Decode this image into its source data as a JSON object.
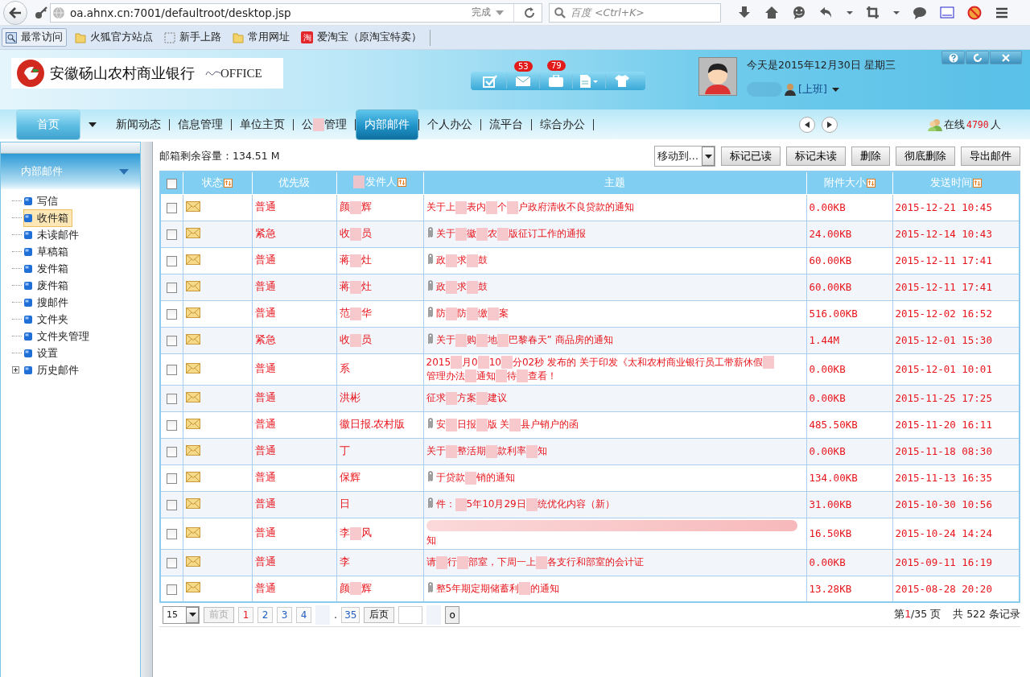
{
  "browser": {
    "url": "oa.ahnx.cn:7001/defaultroot/desktop.jsp",
    "status": "完成",
    "search_placeholder": "百度 <Ctrl+K>",
    "bookmarks": [
      {
        "label": "最常访问",
        "kind": "search"
      },
      {
        "label": "火狐官方站点",
        "kind": "folder"
      },
      {
        "label": "新手上路",
        "kind": "page"
      },
      {
        "label": "常用网址",
        "kind": "folder"
      },
      {
        "label": "爱淘宝（原淘宝特卖）",
        "kind": "shop",
        "mark": "淘"
      }
    ]
  },
  "header": {
    "bank_name": "安徽砀山农村商业银行",
    "product": "OFFICE",
    "toolbar": [
      {
        "kind": "check"
      },
      {
        "kind": "mail",
        "badge": "53"
      },
      {
        "kind": "briefcase",
        "badge": "79"
      },
      {
        "kind": "document"
      },
      {
        "kind": "shirt"
      }
    ],
    "date": "今天是2015年12月30日 星期三",
    "user_status": "[上班]",
    "online": {
      "prefix": "在线",
      "count": "4790",
      "suffix": "人"
    }
  },
  "nav": [
    {
      "kind": "home",
      "label": [
        "首页"
      ],
      "selected": false
    },
    {
      "kind": "item",
      "label": [
        "新闻动态"
      ],
      "selected": false
    },
    {
      "kind": "item",
      "label": [
        "信息管理"
      ],
      "selected": false
    },
    {
      "kind": "item",
      "label": [
        "单位主页"
      ],
      "selected": false
    },
    {
      "kind": "item",
      "label": [
        "公",
        "管理"
      ],
      "selected": false
    },
    {
      "kind": "item",
      "label": [
        "内部邮件"
      ],
      "selected": true
    },
    {
      "kind": "item",
      "label": [
        "个人办公"
      ],
      "selected": false
    },
    {
      "kind": "item",
      "label": [
        "流平台"
      ],
      "selected": false
    },
    {
      "kind": "item",
      "label": [
        "综合办公"
      ],
      "selected": false
    }
  ],
  "sidebar": {
    "title": "内部邮件",
    "items": [
      {
        "label": "写信",
        "selected": false
      },
      {
        "label": "收件箱",
        "selected": true
      },
      {
        "label": "未读邮件",
        "selected": false
      },
      {
        "label": "草稿箱",
        "selected": false
      },
      {
        "label": "发件箱",
        "selected": false
      },
      {
        "label": "废件箱",
        "selected": false
      },
      {
        "label": "搜邮件",
        "selected": false
      },
      {
        "label": "文件夹",
        "selected": false
      },
      {
        "label": "文件夹管理",
        "selected": false
      },
      {
        "label": "设置",
        "selected": false
      },
      {
        "label": "历史邮件",
        "selected": false,
        "expanded": false
      }
    ]
  },
  "mail": {
    "quota": "邮箱剩余容量：134.51 M",
    "move_to": "移动到…",
    "actions": [
      "标记已读",
      "标记未读",
      "删除",
      "彻底删除",
      "导出邮件"
    ],
    "columns": [
      {
        "kind": "checkbox",
        "checked": false
      },
      {
        "kind": "text",
        "label": "状态",
        "sortable": true
      },
      {
        "kind": "text",
        "label": "优先级",
        "sortable": false
      },
      {
        "kind": "text",
        "label": "发件人",
        "sortable": true
      },
      {
        "kind": "text",
        "label": "主题",
        "sortable": false
      },
      {
        "kind": "text",
        "label": "附件大小",
        "sortable": true
      },
      {
        "kind": "text",
        "label": "发送时间",
        "sortable": true
      }
    ],
    "rows": [
      {
        "checked": false,
        "priority": "普通",
        "sender": [
          "颜",
          "辉"
        ],
        "attachment": false,
        "subject": [
          "关于上",
          "表内",
          "个",
          "户政府清收不良贷款的通知"
        ],
        "size": "0.00KB",
        "time": "2015-12-21 10:45"
      },
      {
        "checked": false,
        "priority": "紧急",
        "sender": [
          "收",
          "员"
        ],
        "attachment": true,
        "subject": [
          "关于",
          "徽",
          "农",
          "版征订工作的通报"
        ],
        "size": "24.00KB",
        "time": "2015-12-14 10:43"
      },
      {
        "checked": false,
        "priority": "普通",
        "sender": [
          "蒋",
          "灶"
        ],
        "attachment": true,
        "subject": [
          "政",
          "求",
          "鼓"
        ],
        "size": "60.00KB",
        "time": "2015-12-11 17:41"
      },
      {
        "checked": false,
        "priority": "普通",
        "sender": [
          "蒋",
          "灶"
        ],
        "attachment": true,
        "subject": [
          "政",
          "求",
          "鼓"
        ],
        "size": "60.00KB",
        "time": "2015-12-11 17:41"
      },
      {
        "checked": false,
        "priority": "普通",
        "sender": [
          "范",
          "华"
        ],
        "attachment": true,
        "subject": [
          "防",
          "防",
          "缴",
          "案"
        ],
        "size": "516.00KB",
        "time": "2015-12-02 16:52"
      },
      {
        "checked": false,
        "priority": "紧急",
        "sender": [
          "收",
          "员"
        ],
        "attachment": true,
        "subject": [
          "关于",
          "购",
          "地",
          "巴黎春天” 商品房的通知"
        ],
        "size": "1.44M",
        "time": "2015-12-01 15:30"
      },
      {
        "checked": false,
        "priority": "普通",
        "sender": [
          "系"
        ],
        "attachment": false,
        "subject": [
          "2015",
          "月0",
          "10",
          "分02秒 发布的 关于印发《太和农村商业银行员工带薪休假",
          "管理办法",
          "通知",
          "待",
          "查看！"
        ],
        "size": "0.00KB",
        "time": "2015-12-01 10:01"
      },
      {
        "checked": false,
        "priority": "普通",
        "sender": [
          "洪彬"
        ],
        "attachment": false,
        "subject": [
          "征求",
          "方案",
          "建议"
        ],
        "size": "0.00KB",
        "time": "2015-11-25 17:25"
      },
      {
        "checked": false,
        "priority": "普通",
        "sender": [
          "徽日报.农村版"
        ],
        "attachment": true,
        "subject": [
          "安",
          "日报",
          "版 关",
          "县户销户的函"
        ],
        "size": "485.50KB",
        "time": "2015-11-20 16:11"
      },
      {
        "checked": false,
        "priority": "普通",
        "sender": [
          "丁"
        ],
        "attachment": false,
        "subject": [
          "关于",
          "整活期",
          "款利率",
          "知"
        ],
        "size": "0.00KB",
        "time": "2015-11-18 08:30"
      },
      {
        "checked": false,
        "priority": "普通",
        "sender": [
          "保辉"
        ],
        "attachment": true,
        "subject": [
          "于贷款",
          "销的通知"
        ],
        "size": "134.00KB",
        "time": "2015-11-13 16:35"
      },
      {
        "checked": false,
        "priority": "普通",
        "sender": [
          "日"
        ],
        "attachment": true,
        "subject": [
          "件：",
          "5年10月29日",
          "统优化内容（新）"
        ],
        "size": "31.00KB",
        "time": "2015-10-30 10:56"
      },
      {
        "checked": false,
        "priority": "普通",
        "sender": [
          "李",
          "风"
        ],
        "attachment": false,
        "covered": true,
        "subject": [
          "知"
        ],
        "size": "16.50KB",
        "time": "2015-10-24 14:24"
      },
      {
        "checked": false,
        "priority": "普通",
        "sender": [
          "李"
        ],
        "attachment": false,
        "subject": [
          "请",
          "行",
          "部室，下周一上",
          "各支行和部室的会计证"
        ],
        "size": "0.00KB",
        "time": "2015-09-11 16:19"
      },
      {
        "checked": false,
        "priority": "普通",
        "sender": [
          "颜",
          "辉"
        ],
        "attachment": true,
        "subject": [
          "整5年期定期储蓄利",
          "的通知"
        ],
        "size": "13.28KB",
        "time": "2015-08-28 20:20"
      }
    ],
    "pagination": {
      "page_size": "15",
      "prev": {
        "label": "前页",
        "disabled": true
      },
      "pages": [
        {
          "label": "1",
          "selected": true
        },
        {
          "label": "2",
          "selected": false
        },
        {
          "label": "3",
          "selected": false
        },
        {
          "label": "4",
          "selected": false
        }
      ],
      "ellipsis": ".",
      "last": {
        "label": "35",
        "selected": false
      },
      "next": {
        "label": "后页",
        "disabled": false
      },
      "go": "o",
      "page_info": {
        "prefix": "第",
        "current": "1",
        "suffix": "/35 页"
      },
      "total": "共 522 条记录"
    }
  }
}
